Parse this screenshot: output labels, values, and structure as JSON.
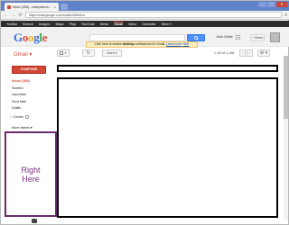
{
  "browser": {
    "tab_title": "Inbox (396) - halbpatisuh...",
    "tab_close": "×",
    "url": "https://mail.google.com/mail/u/0/#inbox",
    "nav_back": "←",
    "nav_forward": "→",
    "nav_reload": "⟳",
    "menu": "≡",
    "win_min": "–",
    "win_max": "□",
    "win_close": "✕"
  },
  "gbar": {
    "items": [
      "+Adiko",
      "Search",
      "Images",
      "Maps",
      "Play",
      "YouTube",
      "News",
      "Gmail",
      "Drive",
      "Calendar",
      "More ▾"
    ],
    "active_index": 7
  },
  "search_row": {
    "logo": [
      "G",
      "o",
      "o",
      "g",
      "l",
      "e"
    ],
    "user_name": "John Wilde",
    "share_label": "+ Share"
  },
  "notice": {
    "text_before": "Click here to enable ",
    "text_bold": "desktop",
    "text_after": " notifications for Gmail.",
    "learn_more": "Learn more",
    "hide": "Hide"
  },
  "toolbar": {
    "gmail_label": "Gmail ▾",
    "refresh": "↻",
    "more_label": "More ▾",
    "page_info": "1–50 of 1,198",
    "prev": "‹",
    "next": "›",
    "settings": "⚙ ▾"
  },
  "sidebar": {
    "compose_label": "COMPOSE",
    "items": [
      {
        "label": "Inbox (396)",
        "active": true
      },
      {
        "label": "Starred",
        "active": false
      },
      {
        "label": "Important",
        "active": false
      },
      {
        "label": "Sent Mail",
        "active": false
      },
      {
        "label": "Drafts",
        "active": false
      }
    ],
    "circles_label": "Circles",
    "circles_prefix": "›",
    "more_labels": "More labels ▾"
  },
  "ad_box": {
    "line1": "Right",
    "line2": "Here"
  },
  "colors": {
    "accent_red": "#dd4b39",
    "ad_border": "#6b2a6f",
    "search_blue": "#4d90fe"
  }
}
